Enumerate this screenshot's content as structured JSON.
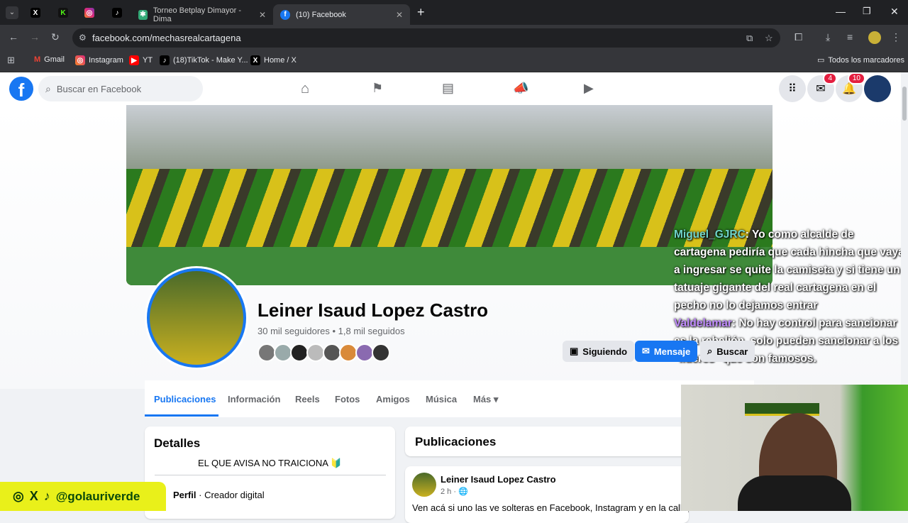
{
  "browser": {
    "tabs": [
      {
        "label": "Torneo Betplay Dimayor - Dima"
      },
      {
        "label": "(10) Facebook"
      }
    ],
    "url": "facebook.com/mechasrealcartagena",
    "bookmarks": [
      "Gmail",
      "Instagram",
      "YT",
      "(18)TikTok - Make Y...",
      "Home / X"
    ],
    "all_bookmarks": "Todos los marcadores"
  },
  "fb": {
    "search_placeholder": "Buscar en Facebook",
    "messenger_badge": "4",
    "notif_badge": "10"
  },
  "chat": [
    {
      "user": "Miguel_GJRC",
      "text": ": Yo como alcalde de cartagena pediría que cada hincha que vaya a ingresar se quite la camiseta y si tiene un tatuaje gigante del real cartagena en el pecho no lo dejamos entrar"
    },
    {
      "user": "Valdelamar",
      "text": ": No hay control para sancionar es la rebelión, solo pueden sancionar a los \"líderes\" que son famosos."
    }
  ],
  "profile": {
    "name": "Leiner Isaud Lopez Castro",
    "stats": "30 mil seguidores • 1,8 mil seguidos",
    "following_btn": "Siguiendo",
    "message_btn": "Mensaje",
    "search_btn": "Buscar"
  },
  "tabs": [
    "Publicaciones",
    "Información",
    "Reels",
    "Fotos",
    "Amigos",
    "Música",
    "Más"
  ],
  "details": {
    "title": "Detalles",
    "bio": "EL QUE AVISA NO TRAICIONA 🔰",
    "profile_label": "Perfil",
    "profile_type": " · Creador digital"
  },
  "posts": {
    "title": "Publicaciones",
    "author": "Leiner Isaud Lopez Castro",
    "time": "2 h ·",
    "text": "Ven acá si uno las ve solteras en Facebook, Instagram y en la calle, en"
  },
  "overlay": {
    "handle": "@golauriverde"
  }
}
